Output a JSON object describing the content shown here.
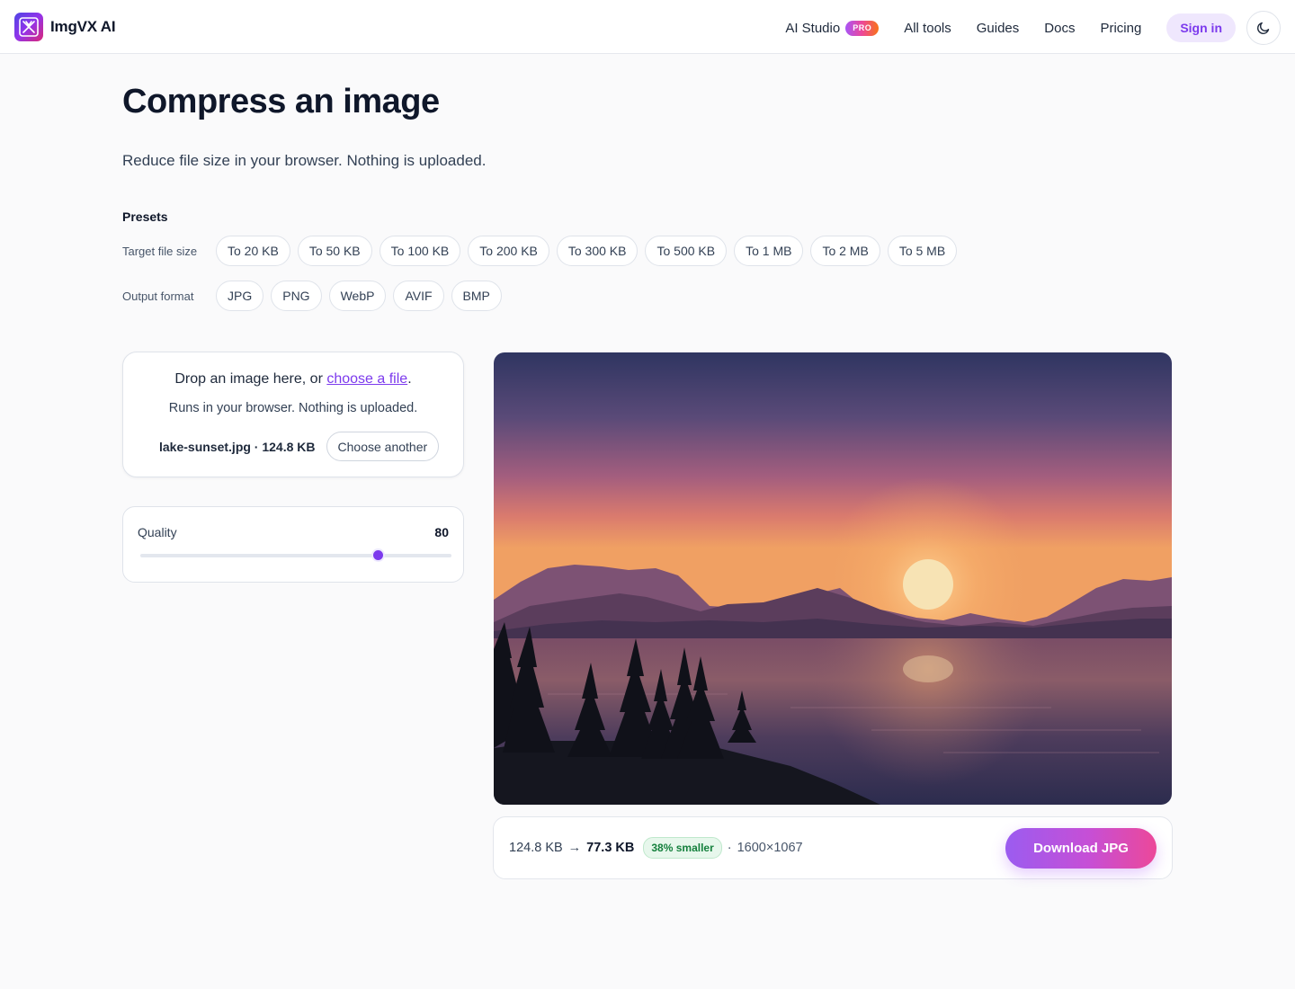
{
  "header": {
    "brand": "ImgVX AI",
    "nav": {
      "ai_studio": "AI Studio",
      "pro_badge": "PRO",
      "all_tools": "All tools",
      "guides": "Guides",
      "docs": "Docs",
      "pricing": "Pricing",
      "sign_in": "Sign in"
    },
    "theme_icon": "moon-icon"
  },
  "page": {
    "title": "Compress an image",
    "subtitle": "Reduce file size in your browser. Nothing is uploaded."
  },
  "presets": {
    "title": "Presets",
    "target_label": "Target file size",
    "target_sizes": [
      "To 20 KB",
      "To 50 KB",
      "To 100 KB",
      "To 200 KB",
      "To 300 KB",
      "To 500 KB",
      "To 1 MB",
      "To 2 MB",
      "To 5 MB"
    ],
    "format_label": "Output format",
    "formats": [
      "JPG",
      "PNG",
      "WebP",
      "AVIF",
      "BMP"
    ]
  },
  "dropzone": {
    "prefix": "Drop an image here, or ",
    "link": "choose a file",
    "suffix": ".",
    "subtext": "Runs in your browser. Nothing is uploaded.",
    "file_info": "lake-sunset.jpg · 124.8 KB",
    "choose_another": "Choose another"
  },
  "quality": {
    "label": "Quality",
    "value": 80,
    "min": 0,
    "max": 100
  },
  "result": {
    "original": "124.8 KB",
    "arrow": "→",
    "compressed": "77.3 KB",
    "badge": "38% smaller",
    "separator": "·",
    "dimensions": "1600×1067",
    "download": "Download JPG"
  },
  "colors": {
    "accent": "#7c3aed",
    "success": "#15803d"
  }
}
